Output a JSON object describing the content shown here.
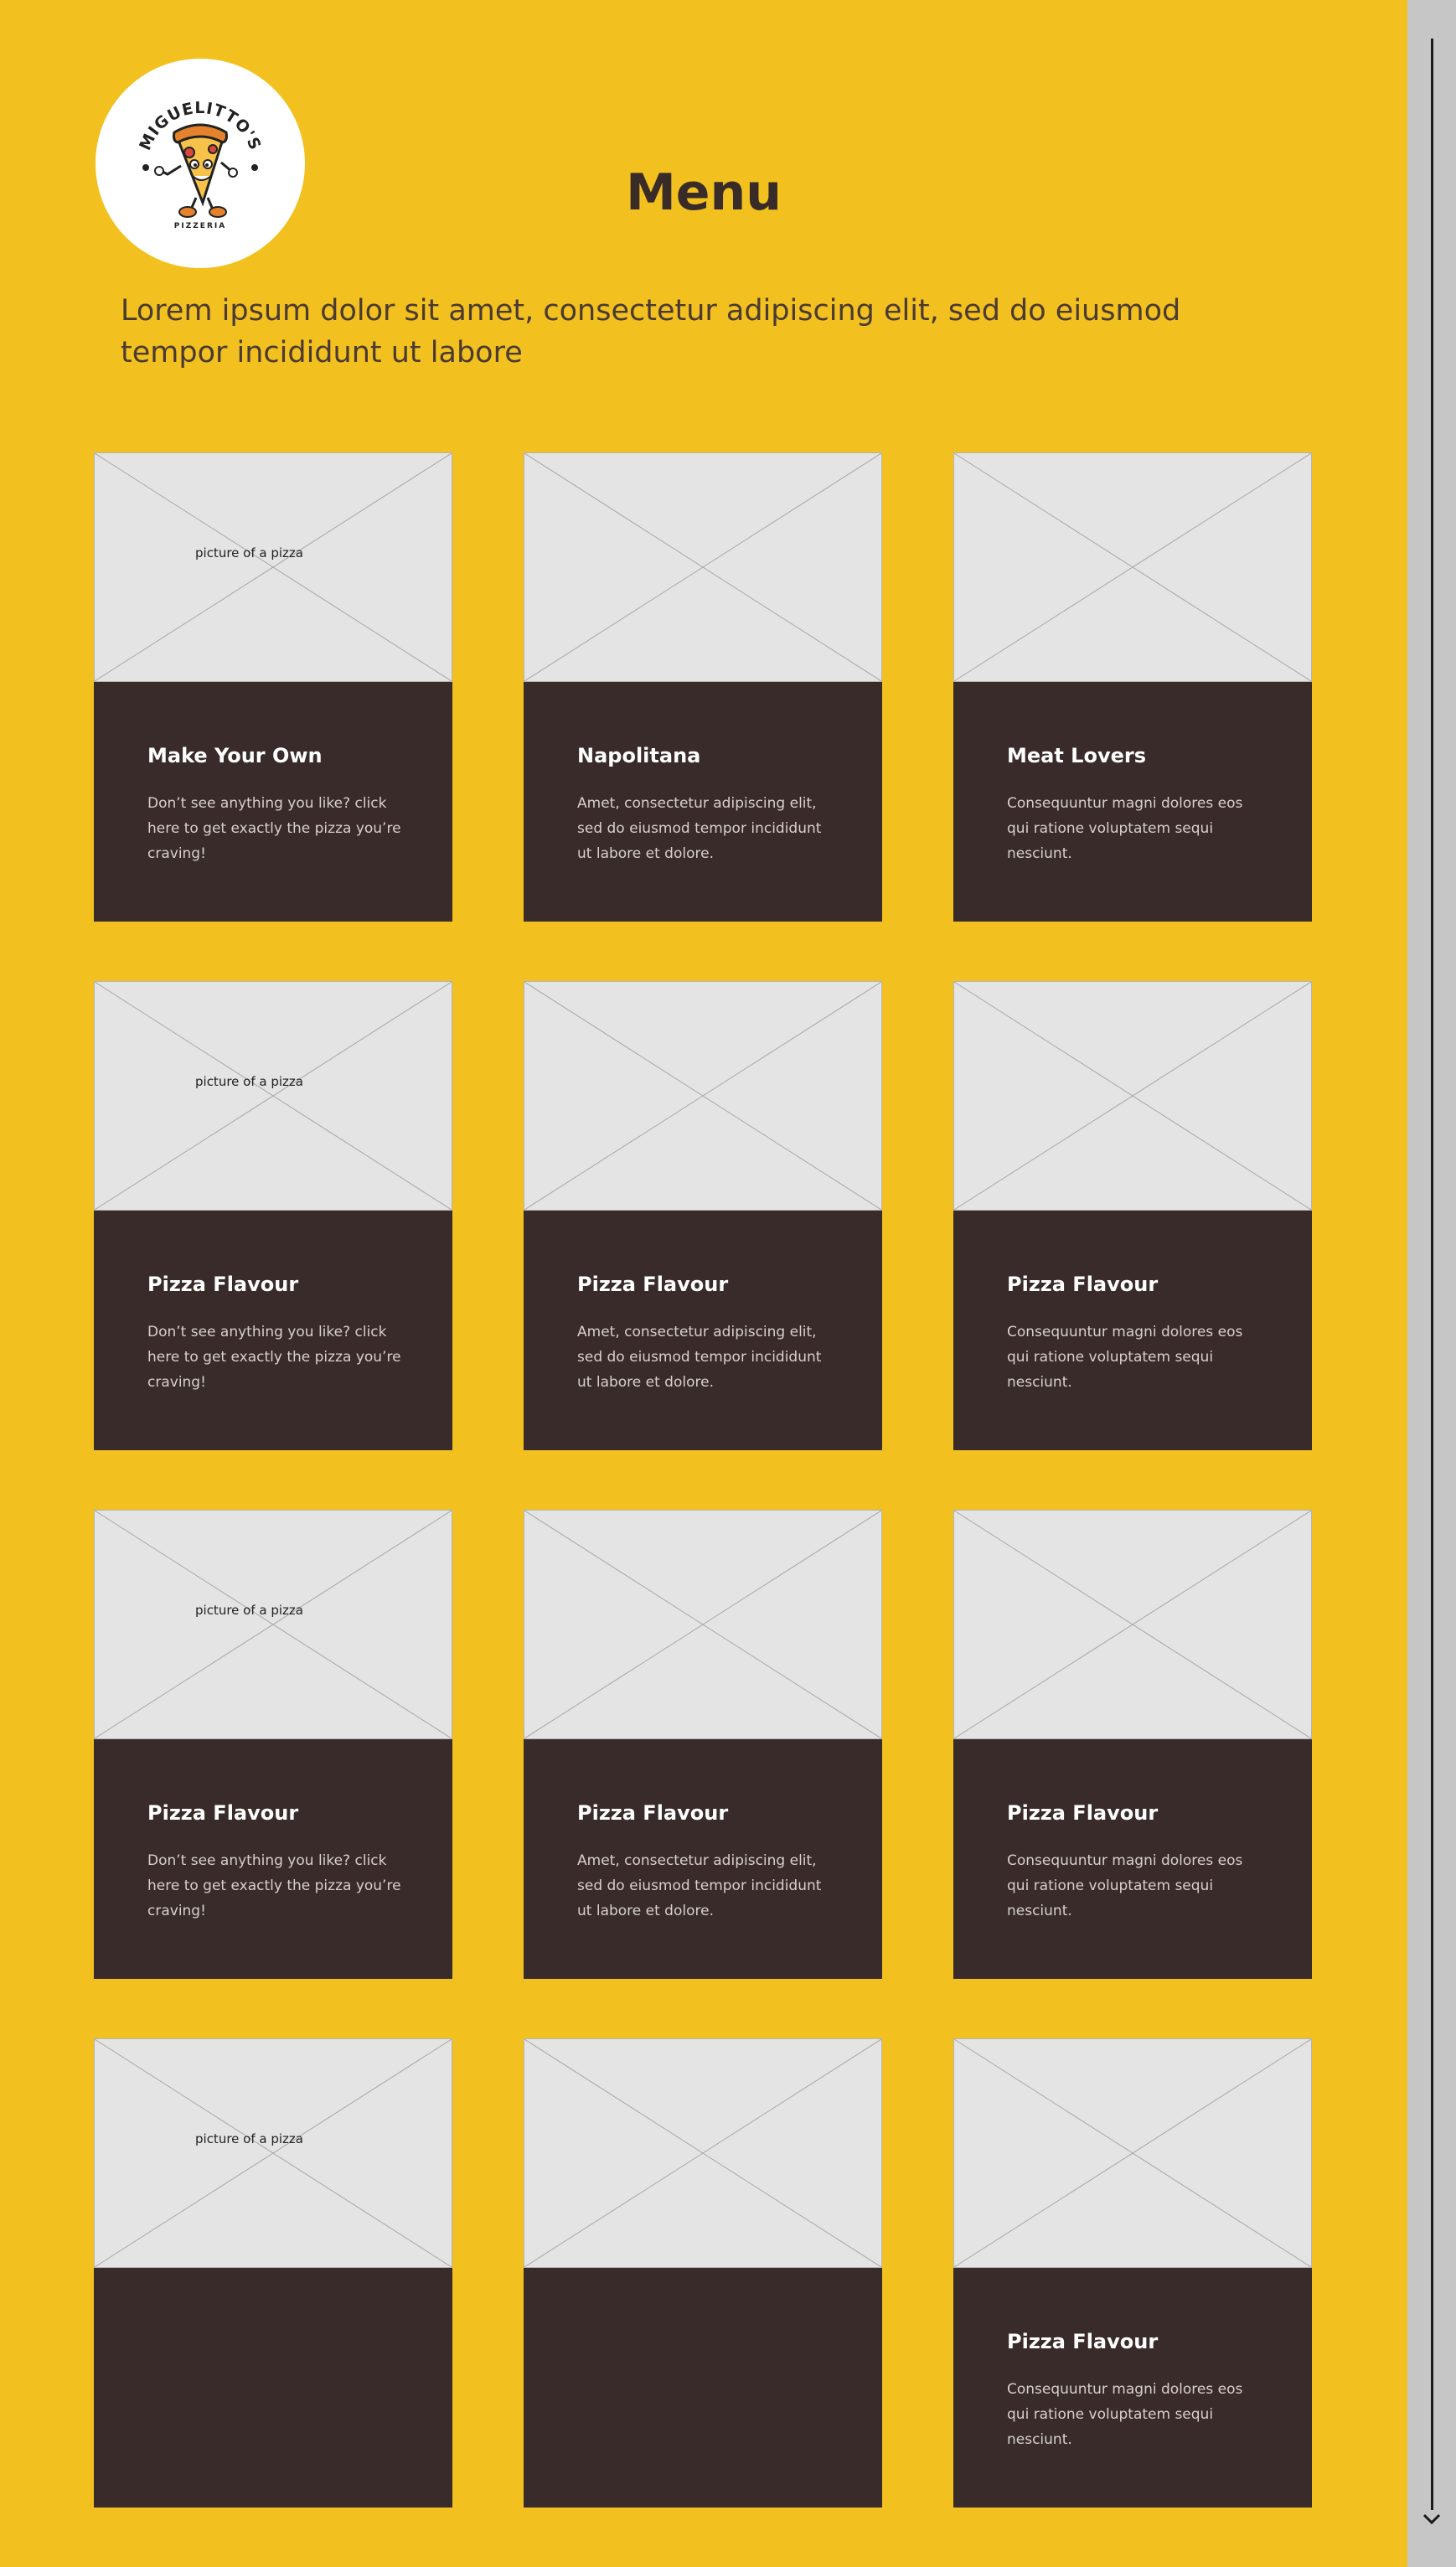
{
  "brand": {
    "name": "MIGUELITTO'S",
    "tagline": "PIZZERIA"
  },
  "header": {
    "title": "Menu",
    "intro": "Lorem ipsum dolor sit amet, consectetur adipiscing elit, sed do eiusmod tempor incididunt ut labore"
  },
  "placeholder_caption": "picture of a pizza",
  "menu": {
    "rows": [
      [
        {
          "title": "Make Your Own",
          "description": "Don’t see anything you like? click here to get exactly the pizza you’re craving!",
          "caption": "picture of a pizza"
        },
        {
          "title": "Napolitana",
          "description": "Amet, consectetur adipiscing elit, sed do eiusmod tempor incididunt ut labore et dolore.",
          "caption": ""
        },
        {
          "title": "Meat Lovers",
          "description": "Consequuntur magni dolores eos qui ratione voluptatem sequi nesciunt.",
          "caption": ""
        }
      ],
      [
        {
          "title": "Pizza Flavour",
          "description": "Don’t see anything you like? click here to get exactly the pizza you’re craving!",
          "caption": "picture of a pizza"
        },
        {
          "title": "Pizza Flavour",
          "description": "Amet, consectetur adipiscing elit, sed do eiusmod tempor incididunt ut labore et dolore.",
          "caption": ""
        },
        {
          "title": "Pizza Flavour",
          "description": "Consequuntur magni dolores eos qui ratione voluptatem sequi nesciunt.",
          "caption": ""
        }
      ],
      [
        {
          "title": "Pizza Flavour",
          "description": "Don’t see anything you like? click here to get exactly the pizza you’re craving!",
          "caption": "picture of a pizza"
        },
        {
          "title": "Pizza Flavour",
          "description": "Amet, consectetur adipiscing elit, sed do eiusmod tempor incididunt ut labore et dolore.",
          "caption": ""
        },
        {
          "title": "Pizza Flavour",
          "description": "Consequuntur magni dolores eos qui ratione voluptatem sequi nesciunt.",
          "caption": ""
        }
      ],
      [
        {
          "title": "",
          "description": "",
          "caption": "picture of a pizza"
        },
        {
          "title": "",
          "description": "",
          "caption": ""
        },
        {
          "title": "Pizza Flavour",
          "description": "Consequuntur magni dolores eos qui ratione voluptatem sequi nesciunt.",
          "caption": ""
        }
      ]
    ]
  },
  "colors": {
    "background": "#f2c01f",
    "card_body": "#382b29",
    "title_text": "#382b28",
    "placeholder": "#e4e4e4",
    "scrollbar": "#c6c6c6"
  },
  "icons": {
    "logo": "pizza-mascot-logo",
    "scroll_down": "arrow-down-icon",
    "image_placeholder": "image-placeholder-icon"
  }
}
